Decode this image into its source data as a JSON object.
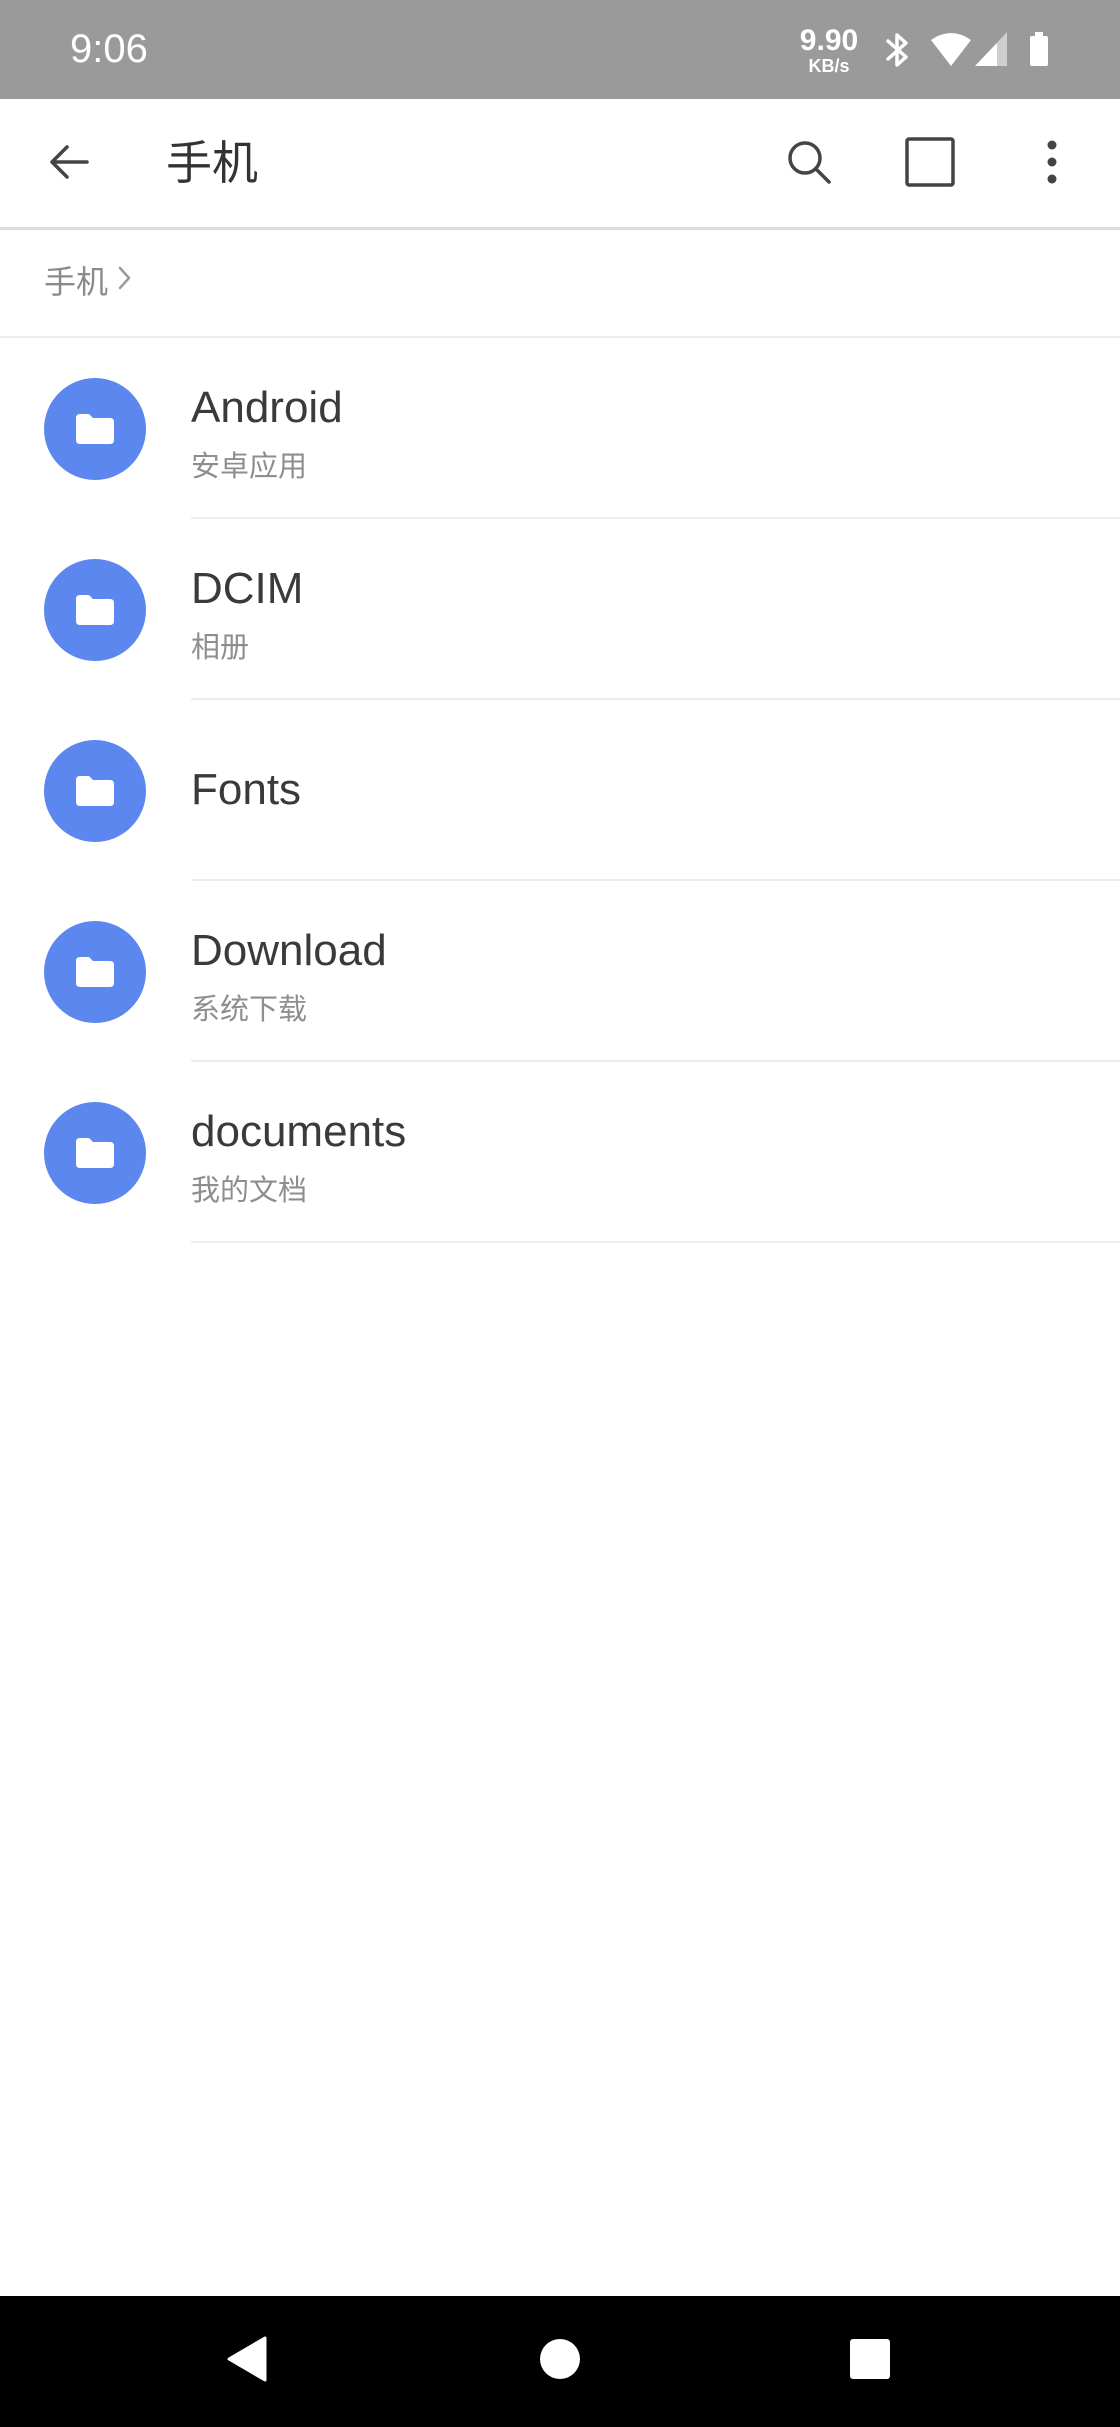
{
  "status_bar": {
    "time": "9:06",
    "net_speed": "9.90",
    "net_speed_unit": "KB/s",
    "icons": [
      "bluetooth-icon",
      "wifi-icon",
      "signal-icon",
      "battery-icon"
    ]
  },
  "toolbar": {
    "title": "手机",
    "icons": [
      "back-arrow-icon",
      "search-icon",
      "select-square-icon",
      "more-vert-icon"
    ]
  },
  "breadcrumb": {
    "items": [
      "手机"
    ]
  },
  "files": [
    {
      "name": "Android",
      "desc": "安卓应用"
    },
    {
      "name": "DCIM",
      "desc": "相册"
    },
    {
      "name": "Fonts",
      "desc": ""
    },
    {
      "name": "Download",
      "desc": "系统下载"
    },
    {
      "name": "documents",
      "desc": "我的文档"
    }
  ],
  "nav_bar": {
    "icons": [
      "nav-back-icon",
      "nav-home-icon",
      "nav-recents-icon"
    ]
  },
  "colors": {
    "folder_accent": "#5b87ee",
    "status_bar_bg": "#9a9a9a"
  }
}
